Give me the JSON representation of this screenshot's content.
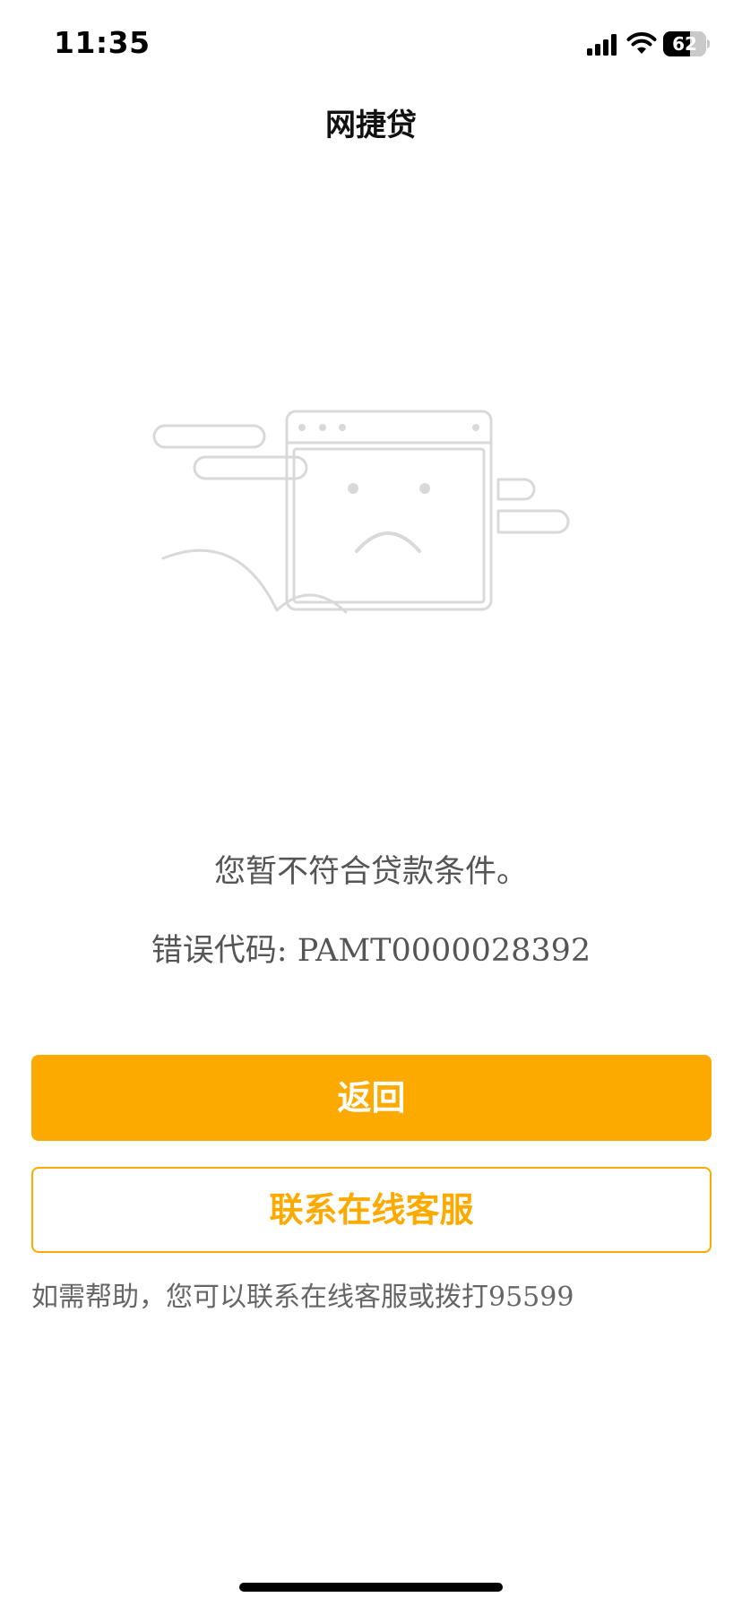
{
  "status_bar": {
    "time": "11:35",
    "battery_level": "62",
    "battery_fraction": 0.62,
    "icons": [
      "cellular-signal-icon",
      "wifi-icon",
      "battery-icon"
    ]
  },
  "header": {
    "title": "网捷贷"
  },
  "illustration": {
    "icon": "sad-browser-window-icon",
    "stroke_color": "#D9D9D9"
  },
  "main": {
    "message": "您暂不符合贷款条件。",
    "error_code": "错误代码: PAMT0000028392"
  },
  "actions": {
    "back_label": "返回",
    "contact_label": "联系在线客服"
  },
  "footer": {
    "help_text": "如需帮助，您可以联系在线客服或拨打95599"
  },
  "colors": {
    "accent": "#FCA900",
    "text_secondary": "#555555",
    "illustration": "#D9D9D9"
  }
}
